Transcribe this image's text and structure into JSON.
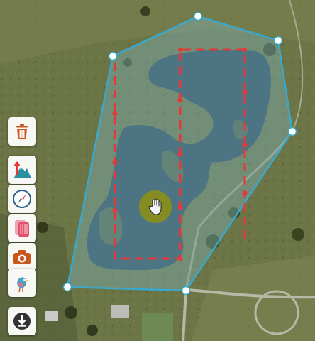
{
  "map": {
    "type": "satellite",
    "survey_polygon_color": "#3aa8cc",
    "flight_path_color": "#e8373a",
    "vertex_color": "#ffffff"
  },
  "toolbar": {
    "items": [
      {
        "icon": "trash-icon",
        "color": "#c8571f"
      },
      {
        "icon": "altitude-mountain-icon",
        "color": "#2a8fa3"
      },
      {
        "icon": "compass-icon",
        "color": "#2b5f8a"
      },
      {
        "icon": "layers-icon",
        "color": "#e0536a"
      },
      {
        "icon": "camera-icon",
        "color": "#c8571f"
      },
      {
        "icon": "bird-icon",
        "color": "#4fa0c8"
      },
      {
        "icon": "download-icon",
        "color": "#333333"
      }
    ]
  },
  "cursor": {
    "icon": "hand-cursor-icon",
    "color": "#8a8f1a"
  }
}
